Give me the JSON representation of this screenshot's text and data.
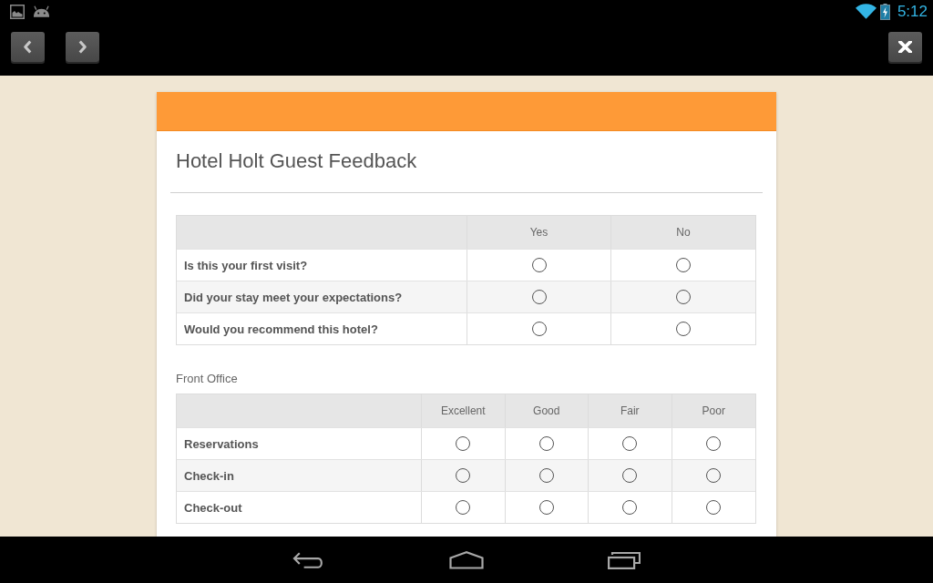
{
  "status_bar": {
    "time": "5:12"
  },
  "form": {
    "title": "Hotel Holt Guest Feedback",
    "sections": [
      {
        "columns": [
          "Yes",
          "No"
        ],
        "rows": [
          {
            "label": "Is this your first visit?",
            "options": [
              {
                "selected": false
              },
              {
                "selected": false
              }
            ]
          },
          {
            "label": "Did your stay meet your expectations?",
            "options": [
              {
                "selected": false
              },
              {
                "selected": false
              }
            ]
          },
          {
            "label": "Would you recommend this hotel?",
            "options": [
              {
                "selected": false
              },
              {
                "selected": false
              }
            ]
          }
        ]
      },
      {
        "heading": "Front Office",
        "columns": [
          "Excellent",
          "Good",
          "Fair",
          "Poor"
        ],
        "rows": [
          {
            "label": "Reservations",
            "options": [
              {
                "selected": false
              },
              {
                "selected": false
              },
              {
                "selected": false
              },
              {
                "selected": false
              }
            ]
          },
          {
            "label": "Check-in",
            "options": [
              {
                "selected": false
              },
              {
                "selected": false
              },
              {
                "selected": false
              },
              {
                "selected": false
              }
            ]
          },
          {
            "label": "Check-out",
            "options": [
              {
                "selected": false
              },
              {
                "selected": false
              },
              {
                "selected": false
              },
              {
                "selected": false
              }
            ]
          }
        ]
      }
    ]
  }
}
